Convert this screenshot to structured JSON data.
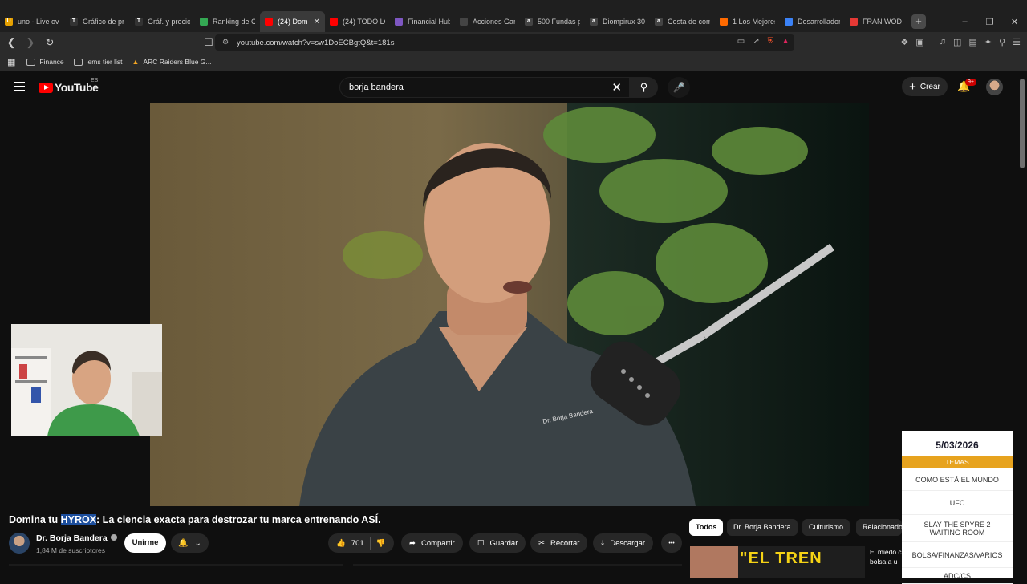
{
  "browser": {
    "tabs": [
      {
        "label": "uno - Live ov",
        "fav": "U",
        "color": "#e6a100"
      },
      {
        "label": "Gráfico de pr",
        "fav": "T",
        "color": "#333"
      },
      {
        "label": "Gráf. y precio",
        "fav": "T",
        "color": "#333"
      },
      {
        "label": "Ranking de C",
        "fav": "",
        "color": "#34a853"
      },
      {
        "label": "(24) Dom",
        "fav": "",
        "color": "#ff0000"
      },
      {
        "label": "(24) TODO LC",
        "fav": "",
        "color": "#ff0000"
      },
      {
        "label": "Financial Hub",
        "fav": "",
        "color": "#7e57c2"
      },
      {
        "label": "Acciones Gan",
        "fav": "",
        "color": "#444"
      },
      {
        "label": "500 Fundas p",
        "fav": "a",
        "color": "#444"
      },
      {
        "label": "Diompirux 30",
        "fav": "a",
        "color": "#444"
      },
      {
        "label": "Cesta de com",
        "fav": "a",
        "color": "#444"
      },
      {
        "label": "1 Los Mejores",
        "fav": "",
        "color": "#ff6a00"
      },
      {
        "label": "Desarrollador",
        "fav": "",
        "color": "#3b82f6"
      },
      {
        "label": "FRAN WOD",
        "fav": "",
        "color": "#e53935"
      }
    ],
    "tab_close": "✕",
    "new_tab": "+",
    "window_controls": [
      "–",
      "❐",
      "✕"
    ],
    "url": "youtube.com/watch?v=sw1DoECBgtQ&t=181s",
    "bookmarks": [
      {
        "label": "Finance"
      },
      {
        "label": "iems tier list"
      },
      {
        "label": "ARC Raiders Blue G..."
      }
    ]
  },
  "youtube": {
    "logo_text": "YouTube",
    "country_code": "ES",
    "search_value": "borja bandera",
    "create_label": "Crear",
    "notifications_badge": "9+"
  },
  "video": {
    "title_prefix": "Domina tu ",
    "title_highlight": "HYROX",
    "title_suffix": ": La ciencia exacta para destrozar tu marca entrenando ASÍ.",
    "channel_name": "Dr. Borja Bandera",
    "subscribers": "1,84 M de suscriptores",
    "join_label": "Unirme",
    "likes": "701",
    "share_label": "Compartir",
    "save_label": "Guardar",
    "clip_label": "Recortar",
    "download_label": "Descargar",
    "more_label": "•••"
  },
  "chips": [
    "Todos",
    "Dr. Borja Bandera",
    "Culturismo",
    "Relacionado"
  ],
  "recommendation": {
    "thumb_text": "\"EL TREN",
    "title": "El miedo c bolsa a u"
  },
  "side_panel": {
    "date": "5/03/2026",
    "header": "TEMAS",
    "items": [
      "COMO ESTÁ EL MUNDO",
      "UFC",
      "SLAY THE SPYRE 2 WAITING ROOM",
      "BOLSA/FINANZAS/VARIOS",
      "ADC/CS"
    ]
  },
  "colors": {
    "youtube_red": "#ff0000",
    "highlight": "#1c4e9d",
    "panel_accent": "#e7a31e"
  }
}
